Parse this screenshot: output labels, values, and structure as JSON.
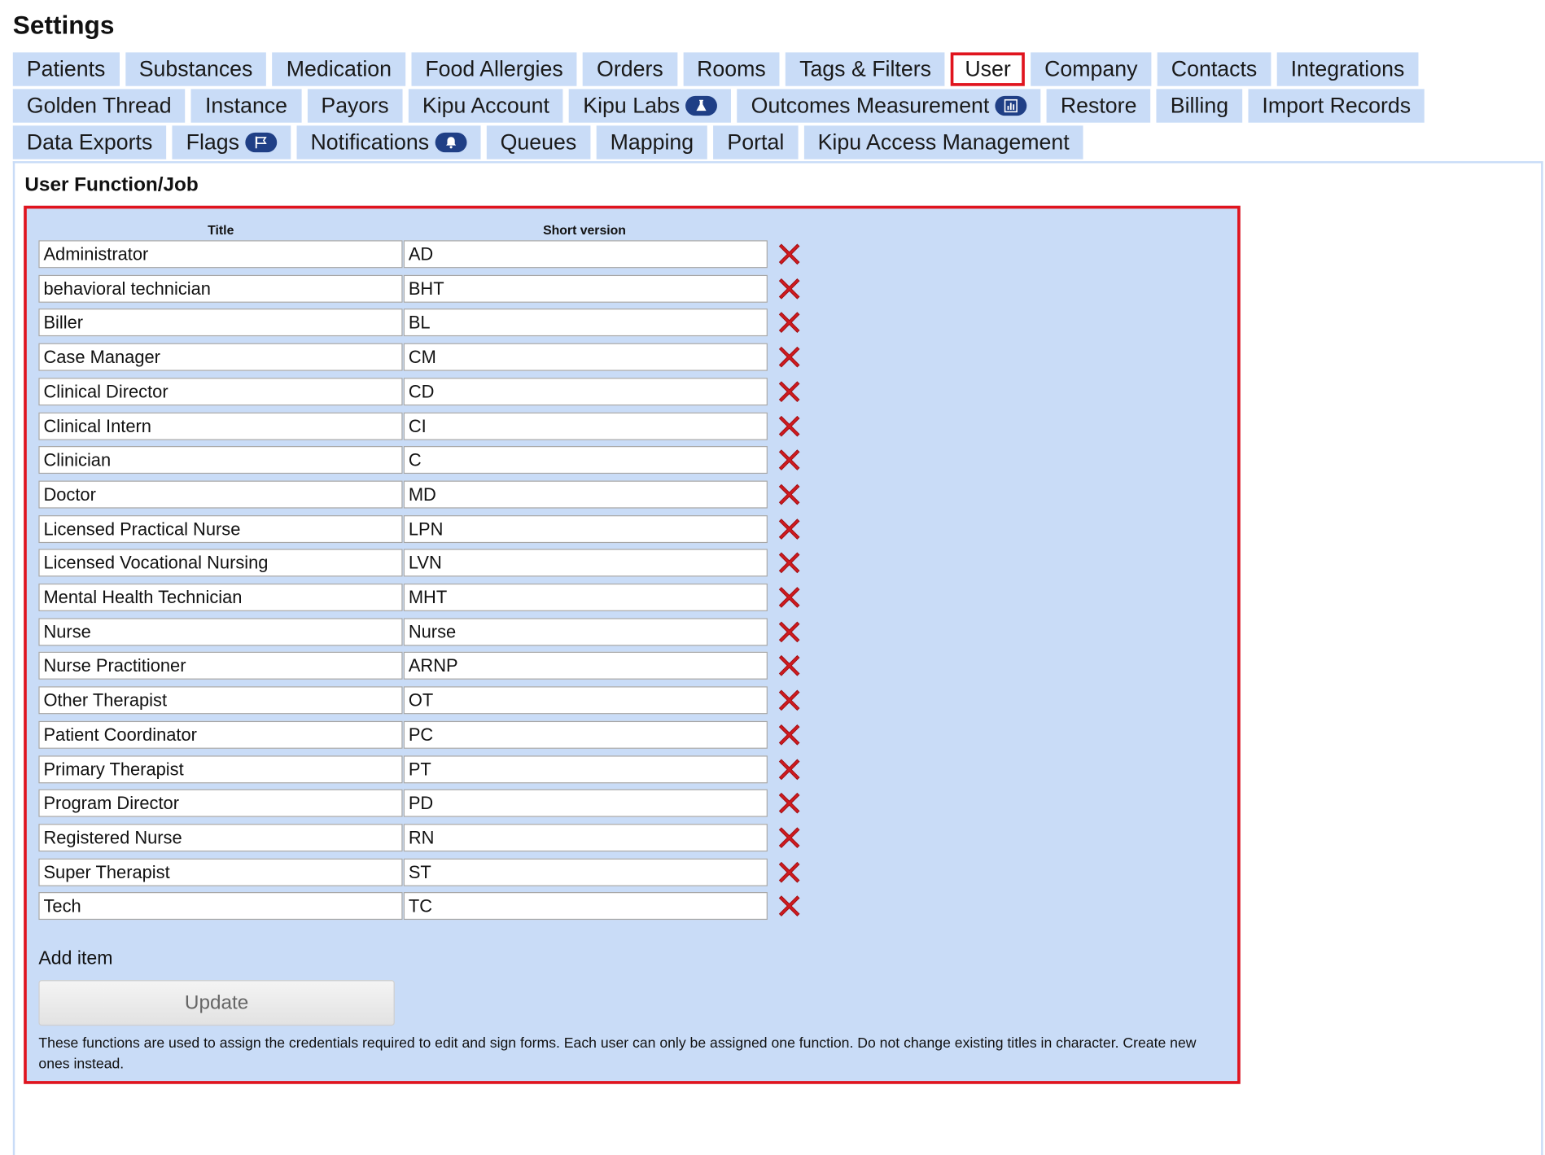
{
  "page": {
    "title": "Settings"
  },
  "tabs": {
    "row1": [
      {
        "label": "Patients",
        "name": "tab-patients"
      },
      {
        "label": "Substances",
        "name": "tab-substances"
      },
      {
        "label": "Medication",
        "name": "tab-medication"
      },
      {
        "label": "Food Allergies",
        "name": "tab-food-allergies"
      },
      {
        "label": "Orders",
        "name": "tab-orders"
      },
      {
        "label": "Rooms",
        "name": "tab-rooms"
      },
      {
        "label": "Tags & Filters",
        "name": "tab-tags-filters"
      },
      {
        "label": "User",
        "name": "tab-user",
        "active": true
      },
      {
        "label": "Company",
        "name": "tab-company"
      },
      {
        "label": "Contacts",
        "name": "tab-contacts"
      },
      {
        "label": "Integrations",
        "name": "tab-integrations"
      }
    ],
    "row2": [
      {
        "label": "Golden Thread",
        "name": "tab-golden-thread"
      },
      {
        "label": "Instance",
        "name": "tab-instance"
      },
      {
        "label": "Payors",
        "name": "tab-payors"
      },
      {
        "label": "Kipu Account",
        "name": "tab-kipu-account"
      },
      {
        "label": "Kipu Labs",
        "name": "tab-kipu-labs",
        "icon": "flask-icon"
      },
      {
        "label": "Outcomes Measurement",
        "name": "tab-outcomes-measurement",
        "icon": "bar-chart-icon"
      },
      {
        "label": "Restore",
        "name": "tab-restore"
      },
      {
        "label": "Billing",
        "name": "tab-billing"
      },
      {
        "label": "Import Records",
        "name": "tab-import-records"
      }
    ],
    "row3": [
      {
        "label": "Data Exports",
        "name": "tab-data-exports"
      },
      {
        "label": "Flags",
        "name": "tab-flags",
        "icon": "flag-icon"
      },
      {
        "label": "Notifications",
        "name": "tab-notifications",
        "icon": "bell-icon"
      },
      {
        "label": "Queues",
        "name": "tab-queues"
      },
      {
        "label": "Mapping",
        "name": "tab-mapping"
      },
      {
        "label": "Portal",
        "name": "tab-portal"
      },
      {
        "label": "Kipu Access Management",
        "name": "tab-kipu-access-management"
      }
    ]
  },
  "section": {
    "title": "User Function/Job",
    "columns": {
      "title": "Title",
      "short": "Short version"
    },
    "rows": [
      {
        "title": "Administrator",
        "short": "AD"
      },
      {
        "title": "behavioral technician",
        "short": "BHT"
      },
      {
        "title": "Biller",
        "short": "BL"
      },
      {
        "title": "Case Manager",
        "short": "CM"
      },
      {
        "title": "Clinical Director",
        "short": "CD"
      },
      {
        "title": "Clinical Intern",
        "short": "CI"
      },
      {
        "title": "Clinician",
        "short": "C"
      },
      {
        "title": "Doctor",
        "short": "MD"
      },
      {
        "title": "Licensed Practical Nurse",
        "short": "LPN"
      },
      {
        "title": "Licensed Vocational Nursing",
        "short": "LVN"
      },
      {
        "title": "Mental Health Technician",
        "short": "MHT"
      },
      {
        "title": "Nurse",
        "short": "Nurse"
      },
      {
        "title": "Nurse Practitioner",
        "short": "ARNP"
      },
      {
        "title": "Other Therapist",
        "short": "OT"
      },
      {
        "title": "Patient Coordinator",
        "short": "PC"
      },
      {
        "title": "Primary Therapist",
        "short": "PT"
      },
      {
        "title": "Program Director",
        "short": "PD"
      },
      {
        "title": "Registered Nurse",
        "short": "RN"
      },
      {
        "title": "Super Therapist",
        "short": "ST"
      },
      {
        "title": "Tech",
        "short": "TC"
      }
    ],
    "delete_icon": "delete-x-icon",
    "add_item_label": "Add item",
    "update_label": "Update",
    "note": "These functions are used to assign the credentials required to edit and sign forms. Each user can only be assigned one function. Do not change existing titles in character. Create new ones instead."
  },
  "colors": {
    "tab_bg": "#c9dcf7",
    "highlight": "#e0141e",
    "badge": "#1f3f86",
    "delete": "#d11a1f"
  }
}
